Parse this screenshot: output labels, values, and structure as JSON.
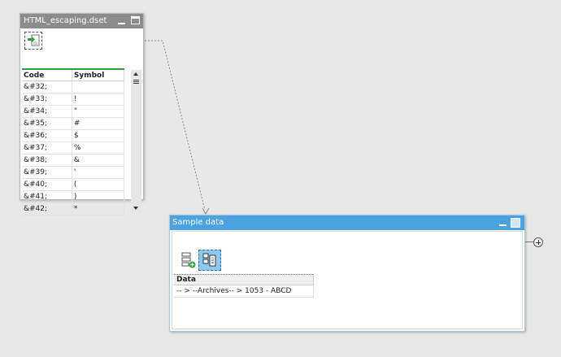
{
  "dataset_node": {
    "title": "HTML_escaping.dset",
    "toolbar_icon": "import-arrow-icon",
    "columns": [
      "Code",
      "Symbol"
    ],
    "rows": [
      {
        "code": "&#32;",
        "symbol": ""
      },
      {
        "code": "&#33;",
        "symbol": "!"
      },
      {
        "code": "&#34;",
        "symbol": "\""
      },
      {
        "code": "&#35;",
        "symbol": "#"
      },
      {
        "code": "&#36;",
        "symbol": "$"
      },
      {
        "code": "&#37;",
        "symbol": "%"
      },
      {
        "code": "&#38;",
        "symbol": "&"
      },
      {
        "code": "&#39;",
        "symbol": "'"
      },
      {
        "code": "&#40;",
        "symbol": "("
      },
      {
        "code": "&#41;",
        "symbol": ")"
      },
      {
        "code": "&#42;",
        "symbol": "*"
      }
    ],
    "colors": {
      "titlebar": "#8c8c8c",
      "header_accent": "#2e9e3a"
    }
  },
  "sample_node": {
    "title": "Sample data",
    "toolbar_icons": [
      "add-row-icon",
      "properties-icon"
    ],
    "columns": [
      "Data"
    ],
    "rows": [
      {
        "data": "-- > --Archives-- > 1053 - ABCD"
      }
    ],
    "colors": {
      "titlebar": "#4aa3df",
      "selected_button": "#8fc8ef"
    }
  },
  "add_port_icon": "add-circle-icon"
}
